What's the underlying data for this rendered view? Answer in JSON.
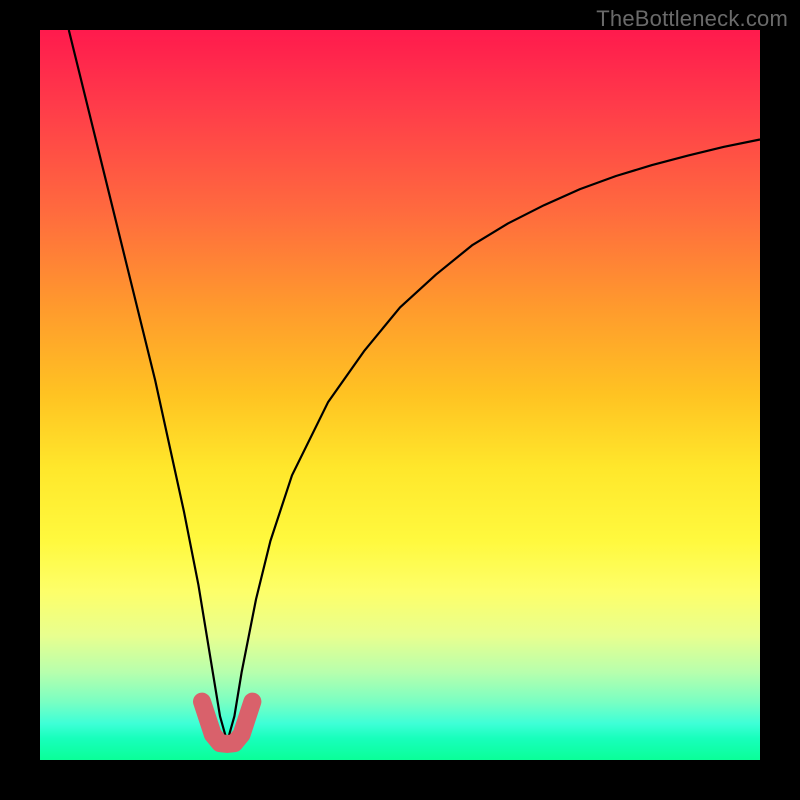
{
  "watermark": "TheBottleneck.com",
  "chart_data": {
    "type": "line",
    "title": "",
    "xlabel": "",
    "ylabel": "",
    "xlim": [
      0,
      100
    ],
    "ylim": [
      0,
      100
    ],
    "x_optimum": 26,
    "series": [
      {
        "name": "bottleneck-curve",
        "color": "#000000",
        "stroke_width": 2.2,
        "x": [
          4,
          6,
          8,
          10,
          12,
          14,
          16,
          18,
          20,
          22,
          24,
          25,
          26,
          27,
          28,
          30,
          32,
          35,
          40,
          45,
          50,
          55,
          60,
          65,
          70,
          75,
          80,
          85,
          90,
          95,
          100
        ],
        "y": [
          100,
          92,
          84,
          76,
          68,
          60,
          52,
          43,
          34,
          24,
          12,
          6,
          2.5,
          6,
          12,
          22,
          30,
          39,
          49,
          56,
          62,
          66.5,
          70.5,
          73.5,
          76,
          78.2,
          80,
          81.5,
          82.8,
          84,
          85
        ]
      },
      {
        "name": "optimum-marker",
        "color": "#d9616b",
        "stroke_width": 18,
        "linecap": "round",
        "x": [
          22.5,
          24,
          25,
          26,
          27,
          28,
          29.5
        ],
        "y": [
          8,
          3.5,
          2.3,
          2.2,
          2.3,
          3.5,
          8
        ]
      }
    ]
  }
}
